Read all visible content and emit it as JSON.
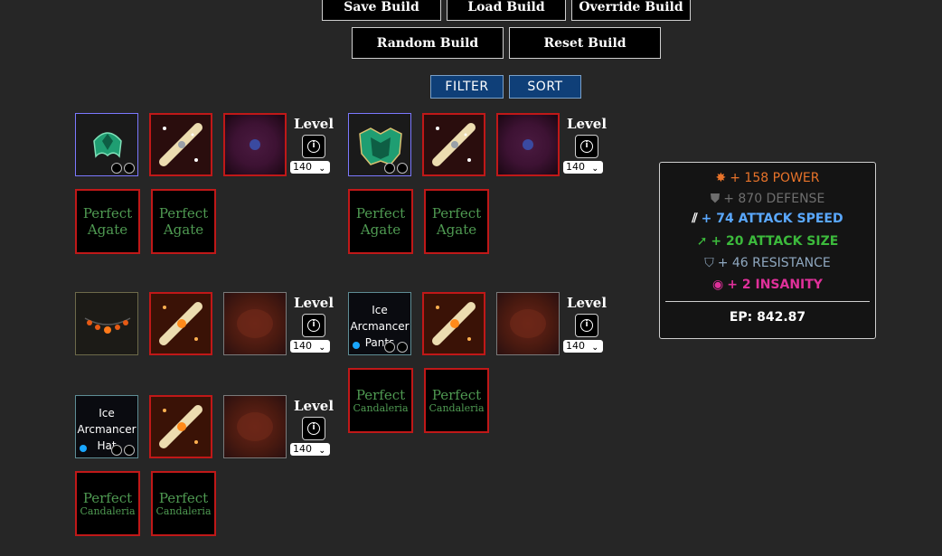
{
  "toolbar": {
    "save_label": "Save Build",
    "load_label": "Load Build",
    "override_label": "Override Build",
    "random_label": "Random Build",
    "reset_label": "Reset Build",
    "filter_label": "FILTER",
    "sort_label": "SORT"
  },
  "equipment": {
    "level_label": "Level",
    "info_icon_glyph": "i",
    "chevron_glyph": "⌄",
    "levels": [
      "140",
      "140",
      "140",
      "140",
      "140"
    ],
    "gems": {
      "agate_1": "Perfect",
      "agate_2": "Agate",
      "candaleria_1": "Perfect",
      "candaleria_2": "Candaleria"
    },
    "ice_pants": [
      "Ice",
      "Arcmancer",
      "Pants"
    ],
    "ice_hat": [
      "Ice",
      "Arcmancer",
      "Hat"
    ]
  },
  "stats": {
    "power": "+ 158 POWER",
    "defense": "+ 870 DEFENSE",
    "attack_speed": "+ 74 ATTACK SPEED",
    "attack_size": "+ 20 ATTACK SIZE",
    "resistance": "+ 46 RESISTANCE",
    "insanity": "+ 2 INSANITY",
    "ep": "EP: 842.87",
    "colors": {
      "power": "#e8732a",
      "defense": "#6e6e6e",
      "attack_speed": "#5aa8ff",
      "attack_size": "#3cba3c",
      "resistance": "#8fa8c0",
      "insanity": "#e0309a"
    }
  }
}
